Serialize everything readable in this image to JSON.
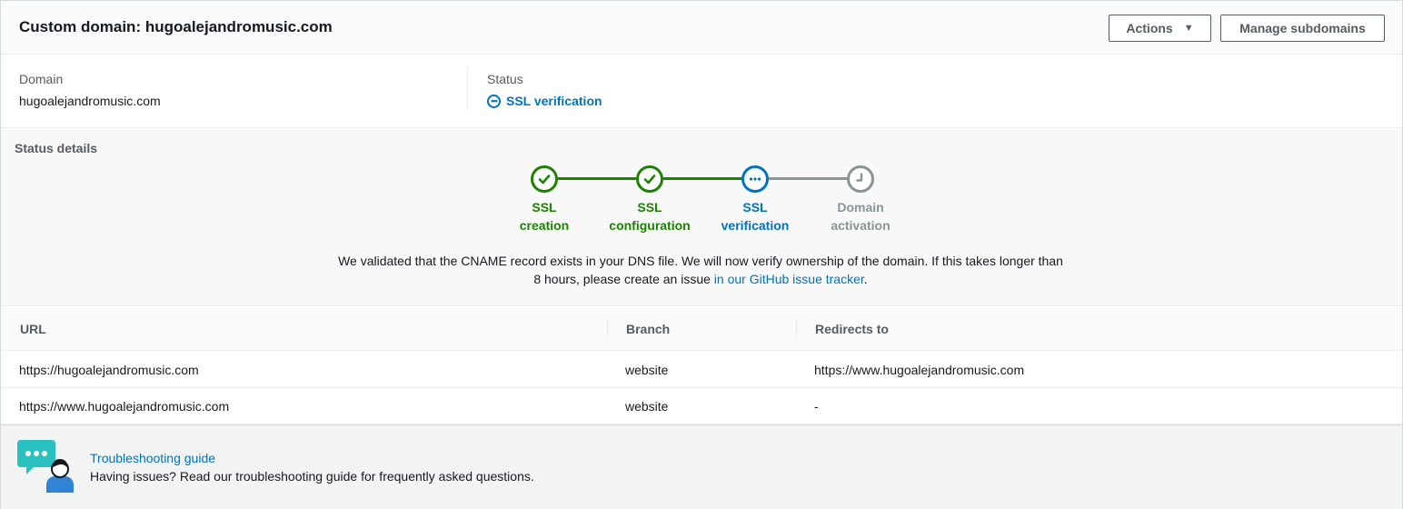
{
  "header": {
    "title": "Custom domain: hugoalejandromusic.com",
    "actions_label": "Actions",
    "manage_subdomains_label": "Manage subdomains"
  },
  "summary": {
    "domain_label": "Domain",
    "domain_value": "hugoalejandromusic.com",
    "status_label": "Status",
    "status_value": "SSL verification"
  },
  "status_details": {
    "title": "Status details",
    "steps": [
      {
        "line1": "SSL",
        "line2": "creation",
        "state": "complete"
      },
      {
        "line1": "SSL",
        "line2": "configuration",
        "state": "complete"
      },
      {
        "line1": "SSL",
        "line2": "verification",
        "state": "in-progress"
      },
      {
        "line1": "Domain",
        "line2": "activation",
        "state": "pending"
      }
    ],
    "message_part1": "We validated that the CNAME record exists in your DNS file. We will now verify ownership of the domain. If this takes longer than 8 hours, please create an issue ",
    "message_link": "in our GitHub issue tracker",
    "message_end": "."
  },
  "table": {
    "columns": [
      "URL",
      "Branch",
      "Redirects to"
    ],
    "rows": [
      {
        "url": "https://hugoalejandromusic.com",
        "branch": "website",
        "redirects_to": "https://www.hugoalejandromusic.com"
      },
      {
        "url": "https://www.hugoalejandromusic.com",
        "branch": "website",
        "redirects_to": "-"
      }
    ]
  },
  "footer": {
    "link": "Troubleshooting guide",
    "description": "Having issues? Read our troubleshooting guide for frequently asked questions."
  },
  "colors": {
    "complete": "#1d8102",
    "in_progress": "#0073bb",
    "pending": "#879596",
    "link": "#0073bb",
    "help_bubble": "#2bc1c1",
    "help_person": "#3184d3"
  },
  "icons": {
    "actions_caret": "caret-down-icon",
    "status": "in-progress-icon",
    "step_complete": "check-circle-icon",
    "step_in_progress": "ellipsis-circle-icon",
    "step_pending": "clock-circle-icon",
    "help": "support-chat-icon"
  }
}
